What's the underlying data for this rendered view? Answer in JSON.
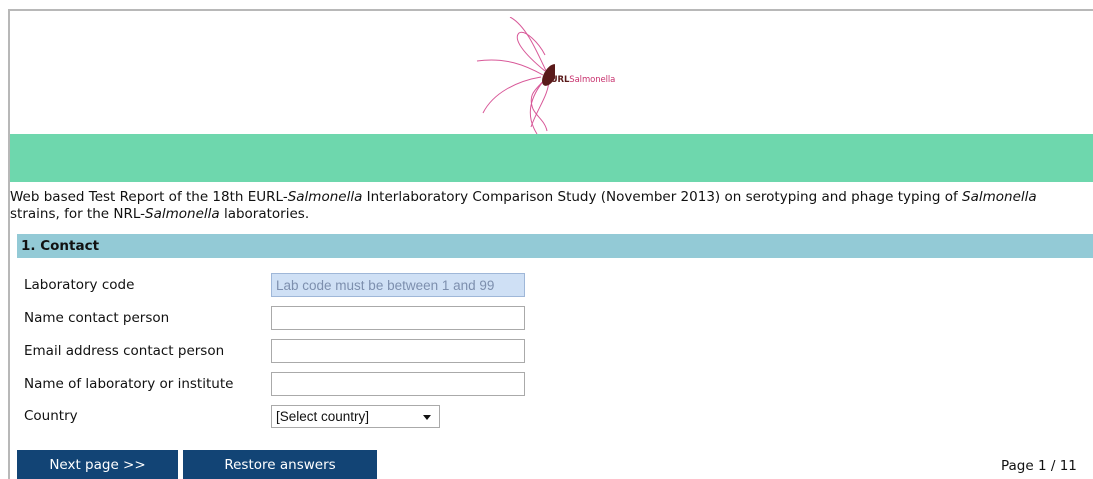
{
  "logo": {
    "brand_prefix": "EURL",
    "brand_suffix": "Salmonella",
    "colors": {
      "cell": "#5a1a1a",
      "flagella": "#d85898"
    }
  },
  "banner": {
    "color": "#6ed7ad"
  },
  "intro": {
    "p1": "Web based Test Report of the 18th EURL-",
    "p1_italic": "Salmonella",
    "p2": " Interlaboratory Comparison Study (November 2013) on serotyping and phage typing of ",
    "p2_italic": "Salmonella",
    "p3": " strains, for the NRL-",
    "p3_italic": "Salmonella",
    "p4": " laboratories."
  },
  "section": {
    "title": "1. Contact",
    "color": "#93cad6"
  },
  "form": {
    "lab_code": {
      "label": "Laboratory code",
      "placeholder": "Lab code must be between 1 and 99",
      "value": ""
    },
    "contact_name": {
      "label": "Name contact person",
      "value": ""
    },
    "contact_email": {
      "label": "Email address contact person",
      "value": ""
    },
    "lab_name": {
      "label": "Name of laboratory or institute",
      "value": ""
    },
    "country": {
      "label": "Country",
      "selected": "[Select country]"
    }
  },
  "buttons": {
    "next": "Next page >>",
    "restore": "Restore answers",
    "color": "#124475"
  },
  "pagination": {
    "text": "Page 1 / 11"
  }
}
